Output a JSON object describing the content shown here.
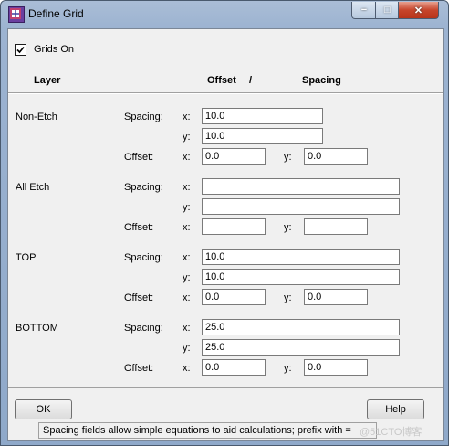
{
  "window": {
    "title": "Define Grid"
  },
  "caption": {
    "minimize": "−",
    "maximize": "□",
    "close": "✕"
  },
  "options": {
    "grids_on_label": "Grids On",
    "grids_on_checked": true
  },
  "headers": {
    "layer": "Layer",
    "offset": "Offset",
    "slash": "/",
    "spacing": "Spacing"
  },
  "labels": {
    "spacing": "Spacing:",
    "offset": "Offset:",
    "x": "x:",
    "y": "y:"
  },
  "layers": [
    {
      "name": "Non-Etch",
      "spacing_x": "10.0",
      "spacing_y": "10.0",
      "offset_x": "0.0",
      "offset_y": "0.0"
    },
    {
      "name": "All Etch",
      "spacing_x": "",
      "spacing_y": "",
      "offset_x": "",
      "offset_y": ""
    },
    {
      "name": "TOP",
      "spacing_x": "10.0",
      "spacing_y": "10.0",
      "offset_x": "0.0",
      "offset_y": "0.0"
    },
    {
      "name": "BOTTOM",
      "spacing_x": "25.0",
      "spacing_y": "25.0",
      "offset_x": "0.0",
      "offset_y": "0.0"
    }
  ],
  "buttons": {
    "ok": "OK",
    "help": "Help"
  },
  "status": {
    "text": "Spacing fields allow simple equations to aid calculations; prefix with ="
  },
  "watermark": "@51CTO博客"
}
